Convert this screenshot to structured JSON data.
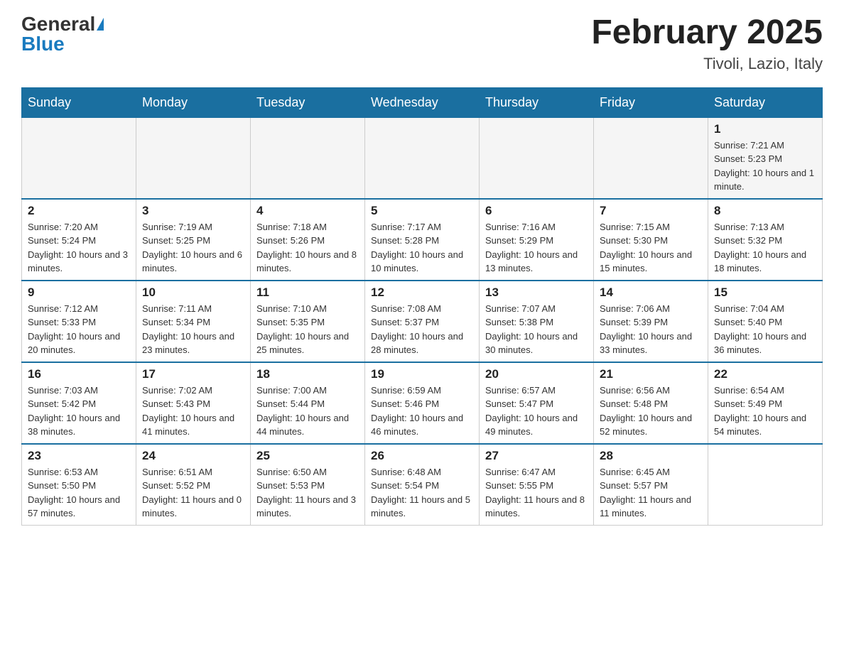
{
  "header": {
    "logo_general": "General",
    "logo_blue": "Blue",
    "month_title": "February 2025",
    "location": "Tivoli, Lazio, Italy"
  },
  "days_of_week": [
    "Sunday",
    "Monday",
    "Tuesday",
    "Wednesday",
    "Thursday",
    "Friday",
    "Saturday"
  ],
  "weeks": [
    [
      {
        "day": "",
        "sunrise": "",
        "sunset": "",
        "daylight": ""
      },
      {
        "day": "",
        "sunrise": "",
        "sunset": "",
        "daylight": ""
      },
      {
        "day": "",
        "sunrise": "",
        "sunset": "",
        "daylight": ""
      },
      {
        "day": "",
        "sunrise": "",
        "sunset": "",
        "daylight": ""
      },
      {
        "day": "",
        "sunrise": "",
        "sunset": "",
        "daylight": ""
      },
      {
        "day": "",
        "sunrise": "",
        "sunset": "",
        "daylight": ""
      },
      {
        "day": "1",
        "sunrise": "Sunrise: 7:21 AM",
        "sunset": "Sunset: 5:23 PM",
        "daylight": "Daylight: 10 hours and 1 minute."
      }
    ],
    [
      {
        "day": "2",
        "sunrise": "Sunrise: 7:20 AM",
        "sunset": "Sunset: 5:24 PM",
        "daylight": "Daylight: 10 hours and 3 minutes."
      },
      {
        "day": "3",
        "sunrise": "Sunrise: 7:19 AM",
        "sunset": "Sunset: 5:25 PM",
        "daylight": "Daylight: 10 hours and 6 minutes."
      },
      {
        "day": "4",
        "sunrise": "Sunrise: 7:18 AM",
        "sunset": "Sunset: 5:26 PM",
        "daylight": "Daylight: 10 hours and 8 minutes."
      },
      {
        "day": "5",
        "sunrise": "Sunrise: 7:17 AM",
        "sunset": "Sunset: 5:28 PM",
        "daylight": "Daylight: 10 hours and 10 minutes."
      },
      {
        "day": "6",
        "sunrise": "Sunrise: 7:16 AM",
        "sunset": "Sunset: 5:29 PM",
        "daylight": "Daylight: 10 hours and 13 minutes."
      },
      {
        "day": "7",
        "sunrise": "Sunrise: 7:15 AM",
        "sunset": "Sunset: 5:30 PM",
        "daylight": "Daylight: 10 hours and 15 minutes."
      },
      {
        "day": "8",
        "sunrise": "Sunrise: 7:13 AM",
        "sunset": "Sunset: 5:32 PM",
        "daylight": "Daylight: 10 hours and 18 minutes."
      }
    ],
    [
      {
        "day": "9",
        "sunrise": "Sunrise: 7:12 AM",
        "sunset": "Sunset: 5:33 PM",
        "daylight": "Daylight: 10 hours and 20 minutes."
      },
      {
        "day": "10",
        "sunrise": "Sunrise: 7:11 AM",
        "sunset": "Sunset: 5:34 PM",
        "daylight": "Daylight: 10 hours and 23 minutes."
      },
      {
        "day": "11",
        "sunrise": "Sunrise: 7:10 AM",
        "sunset": "Sunset: 5:35 PM",
        "daylight": "Daylight: 10 hours and 25 minutes."
      },
      {
        "day": "12",
        "sunrise": "Sunrise: 7:08 AM",
        "sunset": "Sunset: 5:37 PM",
        "daylight": "Daylight: 10 hours and 28 minutes."
      },
      {
        "day": "13",
        "sunrise": "Sunrise: 7:07 AM",
        "sunset": "Sunset: 5:38 PM",
        "daylight": "Daylight: 10 hours and 30 minutes."
      },
      {
        "day": "14",
        "sunrise": "Sunrise: 7:06 AM",
        "sunset": "Sunset: 5:39 PM",
        "daylight": "Daylight: 10 hours and 33 minutes."
      },
      {
        "day": "15",
        "sunrise": "Sunrise: 7:04 AM",
        "sunset": "Sunset: 5:40 PM",
        "daylight": "Daylight: 10 hours and 36 minutes."
      }
    ],
    [
      {
        "day": "16",
        "sunrise": "Sunrise: 7:03 AM",
        "sunset": "Sunset: 5:42 PM",
        "daylight": "Daylight: 10 hours and 38 minutes."
      },
      {
        "day": "17",
        "sunrise": "Sunrise: 7:02 AM",
        "sunset": "Sunset: 5:43 PM",
        "daylight": "Daylight: 10 hours and 41 minutes."
      },
      {
        "day": "18",
        "sunrise": "Sunrise: 7:00 AM",
        "sunset": "Sunset: 5:44 PM",
        "daylight": "Daylight: 10 hours and 44 minutes."
      },
      {
        "day": "19",
        "sunrise": "Sunrise: 6:59 AM",
        "sunset": "Sunset: 5:46 PM",
        "daylight": "Daylight: 10 hours and 46 minutes."
      },
      {
        "day": "20",
        "sunrise": "Sunrise: 6:57 AM",
        "sunset": "Sunset: 5:47 PM",
        "daylight": "Daylight: 10 hours and 49 minutes."
      },
      {
        "day": "21",
        "sunrise": "Sunrise: 6:56 AM",
        "sunset": "Sunset: 5:48 PM",
        "daylight": "Daylight: 10 hours and 52 minutes."
      },
      {
        "day": "22",
        "sunrise": "Sunrise: 6:54 AM",
        "sunset": "Sunset: 5:49 PM",
        "daylight": "Daylight: 10 hours and 54 minutes."
      }
    ],
    [
      {
        "day": "23",
        "sunrise": "Sunrise: 6:53 AM",
        "sunset": "Sunset: 5:50 PM",
        "daylight": "Daylight: 10 hours and 57 minutes."
      },
      {
        "day": "24",
        "sunrise": "Sunrise: 6:51 AM",
        "sunset": "Sunset: 5:52 PM",
        "daylight": "Daylight: 11 hours and 0 minutes."
      },
      {
        "day": "25",
        "sunrise": "Sunrise: 6:50 AM",
        "sunset": "Sunset: 5:53 PM",
        "daylight": "Daylight: 11 hours and 3 minutes."
      },
      {
        "day": "26",
        "sunrise": "Sunrise: 6:48 AM",
        "sunset": "Sunset: 5:54 PM",
        "daylight": "Daylight: 11 hours and 5 minutes."
      },
      {
        "day": "27",
        "sunrise": "Sunrise: 6:47 AM",
        "sunset": "Sunset: 5:55 PM",
        "daylight": "Daylight: 11 hours and 8 minutes."
      },
      {
        "day": "28",
        "sunrise": "Sunrise: 6:45 AM",
        "sunset": "Sunset: 5:57 PM",
        "daylight": "Daylight: 11 hours and 11 minutes."
      },
      {
        "day": "",
        "sunrise": "",
        "sunset": "",
        "daylight": ""
      }
    ]
  ]
}
